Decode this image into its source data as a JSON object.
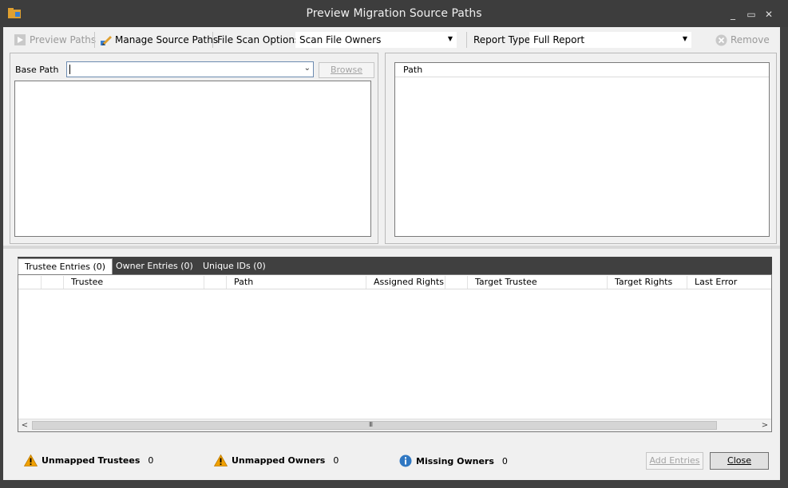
{
  "window": {
    "title": "Preview Migration Source Paths",
    "minimize": "_",
    "maximize": "▭",
    "close": "✕"
  },
  "toolbar": {
    "preview_paths": "Preview Paths",
    "manage_source_paths": "Manage Source Paths",
    "file_scan_label": "File Scan Options:",
    "file_scan_value": "Scan File Owners",
    "report_type_label": "Report Type:",
    "report_type_value": "Full Report",
    "remove": "Remove",
    "dropdown_arrow": "▼"
  },
  "left_pane": {
    "base_path_label": "Base Path",
    "base_path_value": "",
    "browse": "Browse"
  },
  "right_pane": {
    "columns": [
      "Path"
    ]
  },
  "tabs": [
    {
      "label": "Trustee Entries  (0)"
    },
    {
      "label": "Owner Entries  (0)"
    },
    {
      "label": "Unique IDs  (0)"
    }
  ],
  "grid": {
    "columns": [
      "Trustee",
      "Path",
      "Assigned Rights",
      "Target Trustee",
      "Target Rights",
      "Last Error"
    ],
    "rows": [],
    "scroll_left": "<",
    "scroll_right": ">",
    "grip": "III"
  },
  "status": {
    "unmapped_trustees": {
      "label": "Unmapped Trustees",
      "count": "0"
    },
    "unmapped_owners": {
      "label": "Unmapped Owners",
      "count": "0"
    },
    "missing_owners": {
      "label": "Missing Owners",
      "count": "0"
    }
  },
  "buttons": {
    "add_entries": "Add Entries",
    "close": "Close"
  },
  "colors": {
    "titlebar": "#3d3d3d",
    "client": "#f0f0f0",
    "tabstrip": "#404040",
    "warning": "#f0a000",
    "info": "#2f77c2"
  }
}
